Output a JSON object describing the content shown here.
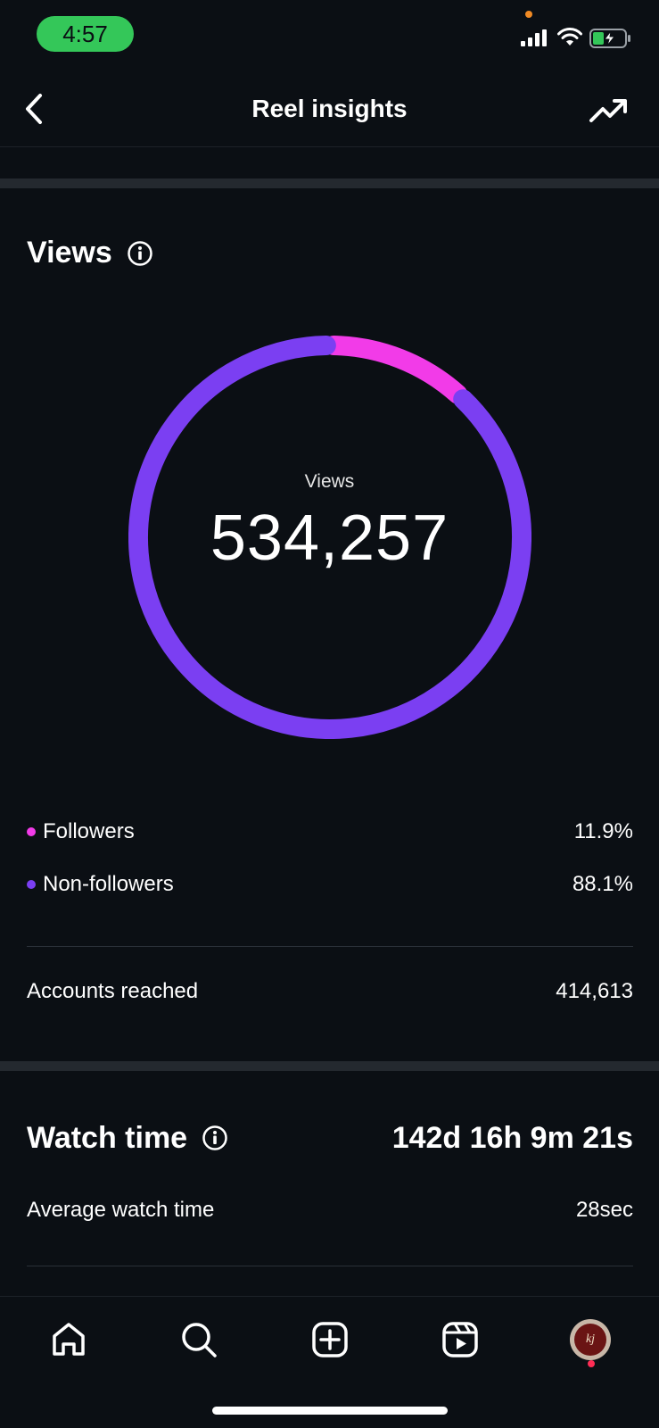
{
  "status_bar": {
    "time": "4:57"
  },
  "header": {
    "title": "Reel insights"
  },
  "views": {
    "section_title": "Views",
    "center_label": "Views",
    "total": "534,257",
    "chart_data": {
      "type": "pie",
      "categories": [
        "Followers",
        "Non-followers"
      ],
      "values": [
        11.9,
        88.1
      ],
      "colors": [
        "#f23be8",
        "#7b3ff2"
      ],
      "title": "Views"
    },
    "legend": [
      {
        "label": "Followers",
        "value": "11.9%",
        "color": "#f23be8"
      },
      {
        "label": "Non-followers",
        "value": "88.1%",
        "color": "#7b3ff2"
      }
    ],
    "accounts_reached": {
      "label": "Accounts reached",
      "value": "414,613"
    }
  },
  "watch_time": {
    "section_title": "Watch time",
    "total": "142d 16h 9m 21s",
    "average": {
      "label": "Average watch time",
      "value": "28sec"
    }
  },
  "avatar": {
    "text": "kj"
  },
  "nav": {
    "items": [
      "home-icon",
      "search-icon",
      "create-icon",
      "reels-icon",
      "profile-avatar"
    ]
  },
  "colors": {
    "background": "#0b0f14",
    "followers": "#f23be8",
    "non_followers": "#7b3ff2",
    "status_pill": "#34c759"
  }
}
